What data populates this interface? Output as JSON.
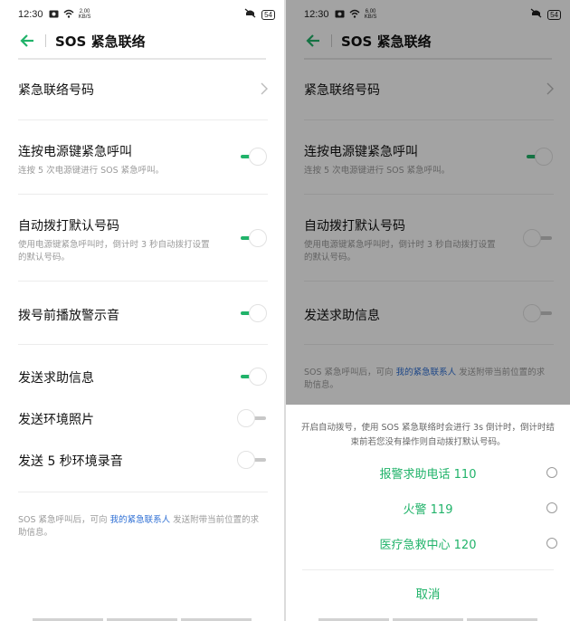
{
  "status_left": {
    "time": "12:30",
    "speed_top": "2.00",
    "speed_bottom": "KB/S",
    "battery": "54"
  },
  "status_right": {
    "time": "12:30",
    "speed_top": "6.00",
    "speed_bottom": "KB/S",
    "battery": "54"
  },
  "header": {
    "title": "SOS 紧急联络"
  },
  "left": {
    "contacts_label": "紧急联络号码",
    "power_press": {
      "label": "连按电源键紧急呼叫",
      "sub": "连按 5 次电源键进行 SOS 紧急呼叫。",
      "on": true
    },
    "auto_dial": {
      "label": "自动拨打默认号码",
      "sub": "使用电源键紧急呼叫时，倒计时 3 秒自动拨打设置的默认号码。",
      "on": true
    },
    "warning_tone": {
      "label": "拨号前播放警示音",
      "on": true
    },
    "send_help": {
      "label": "发送求助信息",
      "on": true
    },
    "send_photo": {
      "label": "发送环境照片",
      "on": false
    },
    "send_audio": {
      "label": "发送 5 秒环境录音",
      "on": false
    },
    "footer": {
      "pre": "SOS 紧急呼叫后，可向 ",
      "link": "我的紧急联系人",
      "post": " 发送附带当前位置的求助信息。"
    }
  },
  "right": {
    "contacts_label": "紧急联络号码",
    "power_press": {
      "label": "连按电源键紧急呼叫",
      "sub": "连按 5 次电源键进行 SOS 紧急呼叫。",
      "on": true
    },
    "auto_dial": {
      "label": "自动拨打默认号码",
      "sub": "使用电源键紧急呼叫时，倒计时 3 秒自动拨打设置的默认号码。",
      "on": false
    },
    "send_help": {
      "label": "发送求助信息",
      "on": false
    },
    "footer": {
      "pre": "SOS 紧急呼叫后，可向 ",
      "link": "我的紧急联系人",
      "post": " 发送附带当前位置的求助信息。"
    },
    "sheet": {
      "note": "开启自动拨号，使用 SOS 紧急联络时会进行 3s 倒计时，倒计时结束前若您没有操作则自动拨打默认号码。",
      "options": [
        "报警求助电话 110",
        "火警 119",
        "医疗急救中心 120"
      ],
      "cancel": "取消"
    }
  },
  "colors": {
    "accent": "#21b36a",
    "link": "#2e6fd4"
  }
}
